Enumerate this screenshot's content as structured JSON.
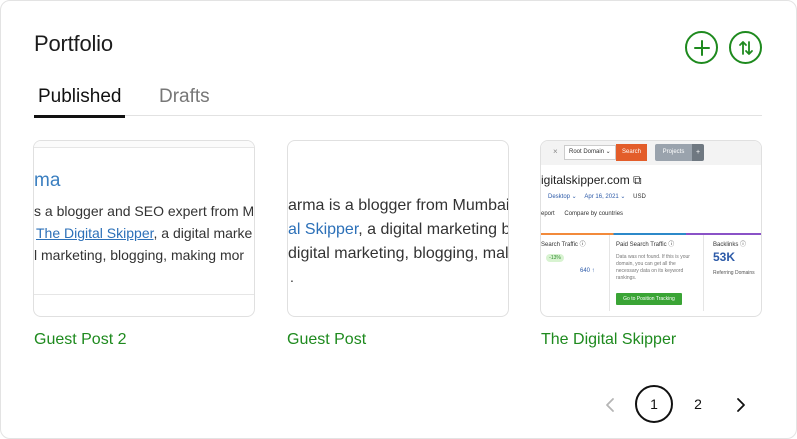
{
  "header": {
    "title": "Portfolio",
    "add_icon": "plus-icon",
    "sort_icon": "sort-arrows-icon"
  },
  "tabs": [
    {
      "label": "Published",
      "active": true
    },
    {
      "label": "Drafts",
      "active": false
    }
  ],
  "cards": [
    {
      "title": "Guest Post 2",
      "thumb": {
        "heading": "ma",
        "line1": "s a blogger and SEO expert from M",
        "line2_link": "The Digital Skipper",
        "line2_rest": ", a digital marke",
        "line3": "l marketing, blogging, making mor"
      }
    },
    {
      "title": "Guest Post",
      "thumb": {
        "line1": "arma is a blogger from Mumbai,",
        "line2_link": "al Skipper",
        "line2_rest": ", a digital marketing bl",
        "line3": " digital marketing, blogging, mal",
        "line4": "."
      }
    },
    {
      "title": "The Digital Skipper",
      "thumb": {
        "close": "×",
        "dropdown": "Root Domain ⌄",
        "search": "Search",
        "projects": "Projects",
        "plus": "+",
        "domain": "igitalskipper.com ⧉",
        "device": "Desktop ⌄",
        "date": "Apr 16, 2021 ⌄",
        "currency": "USD",
        "tab1": "eport",
        "tab2": "Compare by countries",
        "col1_title": "Search Traffic ⓘ",
        "col1_badge": "-13%",
        "col1_value": "640 ↑",
        "col2_title": "Paid Search Traffic ⓘ",
        "col2_note": "Data was not found. If this is your domain, you can get all the necessary data on its keyword rankings.",
        "col2_button": "Go to Position Tracking",
        "col3_title": "Backlinks ⓘ",
        "col3_value": "53K",
        "col3_sub": "Referring Domains"
      }
    }
  ],
  "pagination": {
    "prev_icon": "chevron-left-icon",
    "pages": [
      "1",
      "2"
    ],
    "current": "1",
    "next_icon": "chevron-right-icon"
  },
  "colors": {
    "accent": "#1e8a1e",
    "link": "#2c70b8"
  }
}
